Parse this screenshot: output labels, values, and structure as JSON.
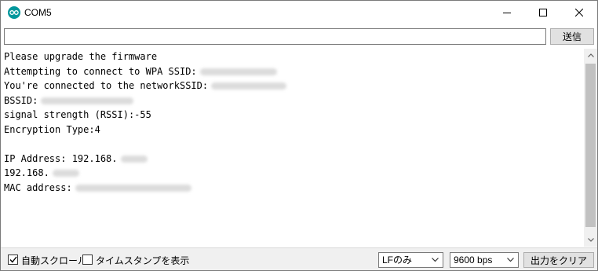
{
  "window": {
    "title": "COM5",
    "app_icon": "arduino-infinity-icon",
    "accent_color": "#00979c"
  },
  "send": {
    "input_value": "",
    "button_label": "送信"
  },
  "output": {
    "lines": [
      {
        "text": "Please upgrade the firmware",
        "redacted": false
      },
      {
        "text": "Attempting to connect to WPA SSID:",
        "redacted": true
      },
      {
        "text": "You're connected to the networkSSID:",
        "redacted": true
      },
      {
        "text": "BSSID:",
        "redacted": true
      },
      {
        "text": "signal strength (RSSI):-55",
        "redacted": false
      },
      {
        "text": "Encryption Type:4",
        "redacted": false
      },
      {
        "text": "",
        "redacted": false
      },
      {
        "text": "IP Address: 192.168.",
        "redacted": true
      },
      {
        "text": "192.168.",
        "redacted": true
      },
      {
        "text": "MAC address:",
        "redacted": true
      }
    ]
  },
  "bottom": {
    "autoscroll_label": "自動スクロール",
    "autoscroll_checked": true,
    "timestamp_label": "タイムスタンプを表示",
    "timestamp_checked": false,
    "line_ending": "LFのみ",
    "baud_rate": "9600 bps",
    "clear_label": "出力をクリア"
  }
}
